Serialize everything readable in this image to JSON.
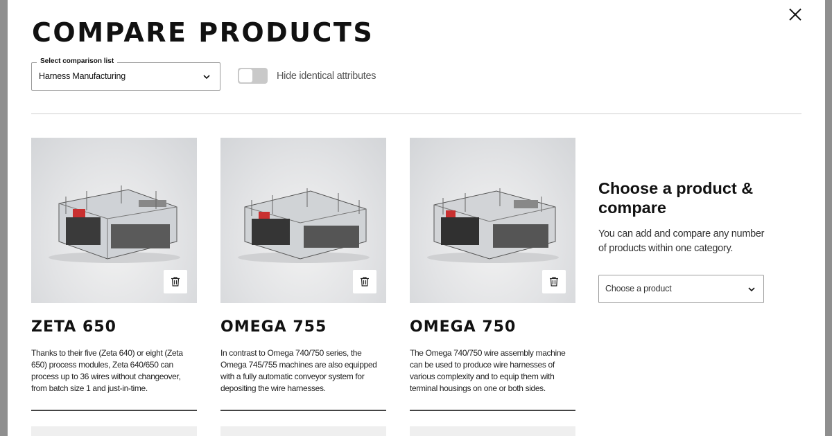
{
  "modal": {
    "title": "COMPARE PRODUCTS",
    "close_icon": "close-icon"
  },
  "comparison_list": {
    "label": "Select comparison list",
    "value": "Harness Manufacturing",
    "icon": "chevron-down-icon"
  },
  "toggle": {
    "label": "Hide identical attributes",
    "checked": false
  },
  "products": [
    {
      "name": "ZETA 650",
      "description": "Thanks to their five (Zeta 640) or eight (Zeta 650) process modules, Zeta 640/650 can process up to 36 wires without changeover, from batch size 1 and just-in-time.",
      "remove_icon": "trash-icon"
    },
    {
      "name": "OMEGA 755",
      "description": "In contrast to Omega 740/750 series, the Omega 745/755 machines are also equipped with a fully automatic conveyor system for depositing the wire harnesses.",
      "remove_icon": "trash-icon"
    },
    {
      "name": "OMEGA 750",
      "description": "The Omega 740/750 wire assembly machine can be used to produce wire harnesses of various complexity and to equip them with terminal housings on one or both sides.",
      "remove_icon": "trash-icon"
    }
  ],
  "add_product": {
    "heading": "Choose a product & compare",
    "text": "You can add and compare any number of products within one category.",
    "select_placeholder": "Choose a product",
    "icon": "chevron-down-icon"
  },
  "colors": {
    "backdrop": "#8f8f8f",
    "panel": "#ffffff",
    "text": "#111111",
    "toggle_off": "#c9c9c9",
    "image_bg": "#e2e3e5"
  }
}
